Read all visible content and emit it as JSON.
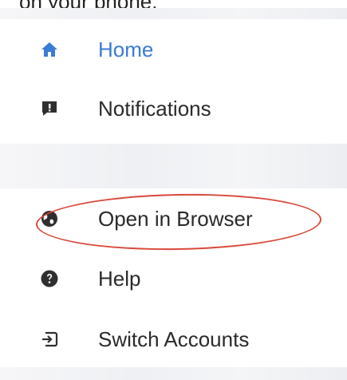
{
  "caption": "on your phone.",
  "menu": {
    "items": [
      {
        "label": "Home",
        "icon": "home-icon",
        "active": true
      },
      {
        "label": "Notifications",
        "icon": "notification-alert-icon",
        "active": false
      },
      {
        "label": "Open in Browser",
        "icon": "globe-icon",
        "active": false
      },
      {
        "label": "Help",
        "icon": "help-icon",
        "active": false
      },
      {
        "label": "Switch Accounts",
        "icon": "switch-account-icon",
        "active": false
      }
    ]
  },
  "colors": {
    "accent": "#3a7bd5",
    "text": "#2a2a2a",
    "annotation": "#d9483b"
  }
}
